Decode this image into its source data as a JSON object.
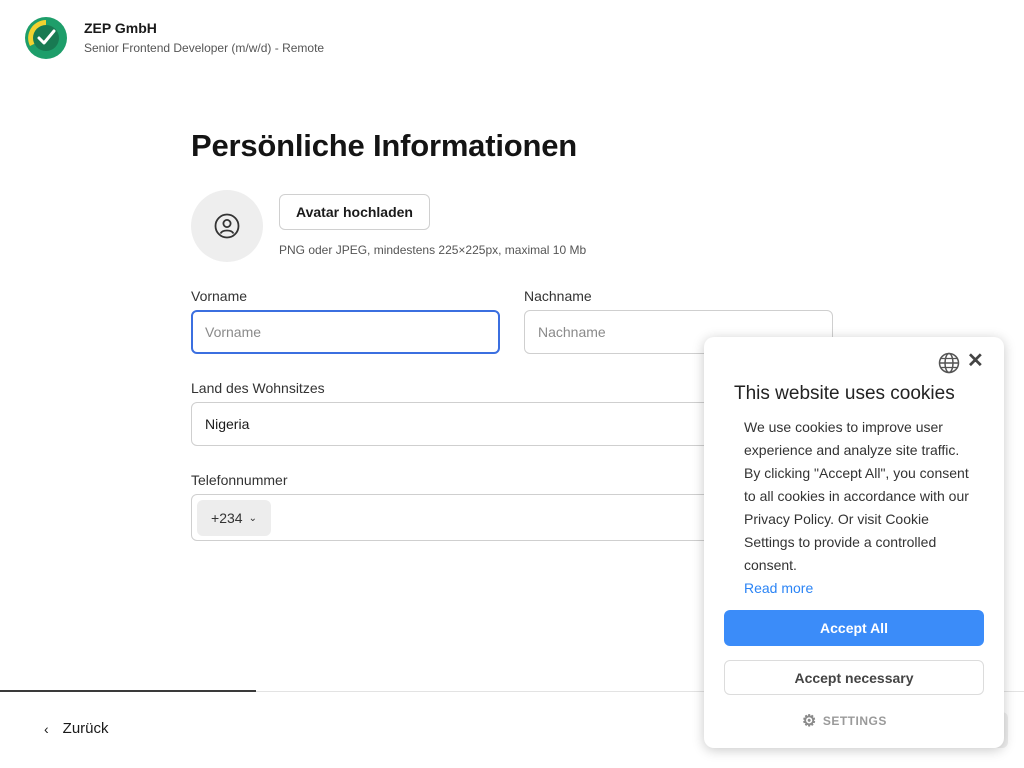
{
  "header": {
    "company_name": "ZEP GmbH",
    "job_title": "Senior Frontend Developer (m/w/d) - Remote"
  },
  "page": {
    "title": "Persönliche Informationen"
  },
  "avatar": {
    "upload_label": "Avatar hochladen",
    "hint": "PNG oder JPEG, mindestens 225×225px, maximal 10 Mb"
  },
  "form": {
    "first_name": {
      "label": "Vorname",
      "placeholder": "Vorname",
      "value": ""
    },
    "last_name": {
      "label": "Nachname",
      "placeholder": "Nachname",
      "value": ""
    },
    "country": {
      "label": "Land des Wohnsitzes",
      "value": "Nigeria"
    },
    "phone": {
      "label": "Telefonnummer",
      "dial_code": "+234",
      "value": ""
    }
  },
  "footer": {
    "back_label": "Zurück",
    "progress": 0.25
  },
  "cookie": {
    "title": "This website uses cookies",
    "body": "We use cookies to improve user experience and analyze site traffic. By clicking \"Accept All\", you consent to all cookies in accordance with our Privacy Policy. Or visit Cookie Settings to provide a controlled consent.",
    "read_more": "Read more",
    "accept_all": "Accept All",
    "accept_necessary": "Accept necessary",
    "settings": "SETTINGS"
  },
  "colors": {
    "focus_border": "#3b6fe0",
    "primary_button": "#3b8cf9",
    "link": "#2b84f5",
    "logo_green": "#1e9e6a",
    "logo_yellow": "#f2d230"
  },
  "icons": {
    "logo": "clock-check-logo",
    "avatar": "user-circle-icon",
    "country_chevron": "chevron-down-icon",
    "back": "chevron-left-icon",
    "cookie_language": "globe-icon",
    "cookie_close": "close-icon",
    "cookie_settings": "gear-icon"
  }
}
